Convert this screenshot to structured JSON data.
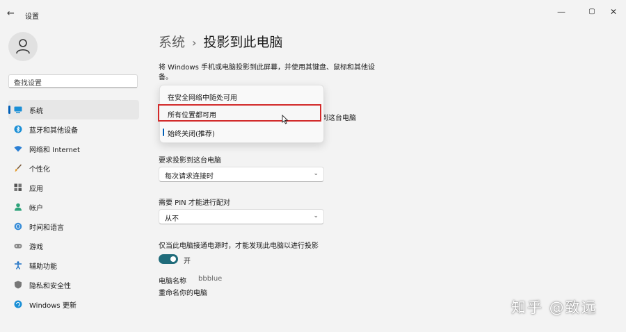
{
  "window": {
    "title": "设置",
    "back_icon": "←",
    "minimize_icon": "—",
    "maximize_icon": "▢",
    "close_icon": "✕"
  },
  "search": {
    "placeholder": "查找设置",
    "icon": "⌕"
  },
  "sidebar": {
    "items": [
      {
        "label": "系统",
        "icon": "system-icon",
        "active": true
      },
      {
        "label": "蓝牙和其他设备",
        "icon": "bluetooth-icon"
      },
      {
        "label": "网络和 Internet",
        "icon": "wifi-icon"
      },
      {
        "label": "个性化",
        "icon": "brush-icon"
      },
      {
        "label": "应用",
        "icon": "apps-icon"
      },
      {
        "label": "帐户",
        "icon": "account-icon"
      },
      {
        "label": "时间和语言",
        "icon": "globe-icon"
      },
      {
        "label": "游戏",
        "icon": "gamepad-icon"
      },
      {
        "label": "辅助功能",
        "icon": "accessibility-icon"
      },
      {
        "label": "隐私和安全性",
        "icon": "shield-icon"
      },
      {
        "label": "Windows 更新",
        "icon": "update-icon"
      }
    ]
  },
  "breadcrumb": {
    "parent": "系统",
    "separator": "›",
    "current": "投影到此电脑"
  },
  "description": "将 Windows 手机或电脑投影到此屏幕，并使用其键盘、鼠标和其他设备。",
  "occluded_text": "到这台电脑",
  "dropdown_menu": {
    "options": [
      {
        "label": "在安全网络中随处可用"
      },
      {
        "label": "所有位置都可用",
        "hovered": true
      },
      {
        "label": "始终关闭(推荐)",
        "selected": true
      }
    ]
  },
  "require_projection": {
    "label": "要求投影到这台电脑",
    "value": "每次请求连接时",
    "chevron": "⌄"
  },
  "pin_pairing": {
    "label": "需要 PIN 才能进行配对",
    "value": "从不",
    "chevron": "⌄"
  },
  "discover_plugged": {
    "label": "仅当此电脑接通电源时，才能发现此电脑以进行投影",
    "toggle_label": "开",
    "on": true
  },
  "pc_name": {
    "label": "电脑名称",
    "value": "bbblue"
  },
  "rename_link": "重命名你的电脑",
  "watermark": "知乎 @致远",
  "colors": {
    "accent": "#005fb8",
    "toggle": "#1f6b7a",
    "highlight_box": "#d22a2a"
  }
}
